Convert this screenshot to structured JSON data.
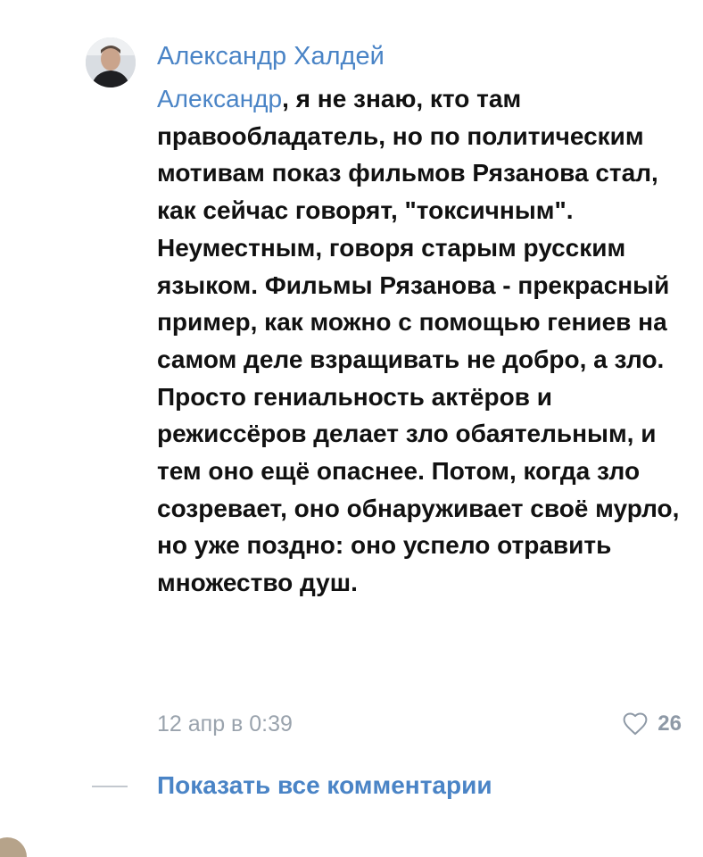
{
  "comment": {
    "author": "Александр Халдей",
    "reply_to": "Александр",
    "text": ", я не знаю, кто там правообладатель, но по политическим мотивам показ фильмов Рязанова стал, как сейчас говорят, \"токсичным\". Неуместным, говоря старым русским языком. Фильмы Рязанова - прекрасный пример, как можно с помощью гениев на самом деле взращивать не добро, а зло. Просто гениальность актёров и режиссёров делает зло обаятельным, и тем оно ещё опаснее. Потом, когда зло созревает, оно обнаруживает своё мурло, но уже поздно: оно успело отравить множество душ.",
    "date": "12 апр в 0:39",
    "like_icon": "heart-outline-icon",
    "likes": "26"
  },
  "show_all_comments": "Показать все комментарии",
  "colors": {
    "link": "#4a84c6",
    "text": "#111111",
    "muted": "#9aa3ad",
    "like": "#8e99a6"
  }
}
